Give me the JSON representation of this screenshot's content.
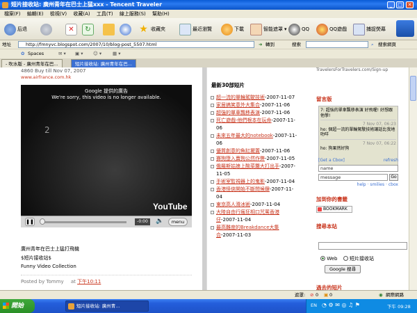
{
  "window": {
    "title": "短片接收站: 廣州青年在巴士上猛xxx - Tencent Traveler"
  },
  "menu": [
    "檔案(F)",
    "編輯(E)",
    "檢視(V)",
    "收藏(A)",
    "工具(T)",
    "線上服務(S)",
    "幫助(H)"
  ],
  "toolbar": {
    "back": "后退",
    "favorites": "收藏夾",
    "recent": "最近瀏覽",
    "download": "下載",
    "smart_block": "智能遮罩",
    "qq": "QQ",
    "qq_game": "QQ遊戲",
    "capture": "捕捉熒幕"
  },
  "address": {
    "label": "地址",
    "url": "http://fmnyvc.blogspot.com/2007/10/blog-post_5507.html",
    "go": "轉到",
    "search_label": "搜索",
    "search_web": "搜索網頁"
  },
  "linkbar": {
    "spaces": "Spaces"
  },
  "tabs": [
    {
      "label": "- 吹水版 - 廣州青年在巴..."
    },
    {
      "label": "短片接收站: 廣州青年在巴..."
    }
  ],
  "left": {
    "promo_line": "4860 Buy till Nov 07, 2007",
    "promo_url": "www.airfrance.com.hk",
    "ad_label": "Google 提供的廣告",
    "video_msg": "We're sorry, this video is no longer available.",
    "video_number": "2",
    "time": "-0:00",
    "menu_btn": "menu",
    "youtube": "YouTube",
    "caption1": "廣州青年在巴士上猛打飛機",
    "caption2": "$短片接收站$",
    "caption3": "Funny Video Collection",
    "posted_by": "Posted by Tommy",
    "posted_at": "at",
    "posted_time": "下午10:11"
  },
  "middle": {
    "heading": "最新30部短片",
    "items": [
      {
        "title": "超一流的單輪駕駛技術",
        "date": "-2007-11-07"
      },
      {
        "title": "家居搞笑意外大集合",
        "date": "-2007-11-06"
      },
      {
        "title": "超強的單車飄移表演",
        "date": "-2007-11-06"
      },
      {
        "title": "死亡遊戲-他們根本在玩命",
        "date": "-2007-11-06"
      },
      {
        "title": "未來五年最大的notebook",
        "date": "-2007-11-06"
      },
      {
        "title": "優質創意的魚缸擺置",
        "date": "-2007-11-06"
      },
      {
        "title": "賽狗墮入賣狗公然作弊",
        "date": "-2007-11-05"
      },
      {
        "title": "俄羅斯姑娘上酸菜籮大打出手",
        "date": "-2007-11-05"
      },
      {
        "title": "手術室監視器上的鬼影",
        "date": "-2007-11-04"
      },
      {
        "title": "香港怪俠開始不斷問候肆",
        "date": "-2007-11-04"
      },
      {
        "title": "東京高人滑冰術",
        "date": "-2007-11-04"
      },
      {
        "title": "大陸自由行瘋狂相口咒罵香港仔",
        "date": "-2007-11-04"
      },
      {
        "title": "最高難度的Breakdance大集合",
        "date": "-2007-11-03"
      }
    ]
  },
  "right": {
    "signup": "TravelersForTravelers.com/Sign-up",
    "guestbook": "留言版",
    "cbox_messages": [
      {
        "text": "7: 超強的單車飄移表演 好飛喔! 好想跟他學!"
      },
      {
        "time": "7 Nov 07, 06:23",
        "text": "ho: 個超一流的單輪駕駛技術讓話比我地叻咩"
      },
      {
        "time": "7 Nov 07, 06:22",
        "text": "ho: 狗果然好狗"
      }
    ],
    "get_cbox": "[Get a Cbox]",
    "refresh": "refresh",
    "name_ph": "name",
    "message_ph": "message",
    "go_btn": "Go",
    "links": "help · smilies · cbox",
    "bookmark_heading": "加到你的書籤",
    "bookmark_btn": "BOOKMARK",
    "search_heading": "搜尋本站",
    "radio_web": "Web",
    "radio_site": "短片接收站",
    "google_btn": "Google 搜尋",
    "past_heading": "過去的短片"
  },
  "status": {
    "left": "遮罩:",
    "count1": "0",
    "count2": "0",
    "zoom": "網際網路"
  },
  "taskbar": {
    "start": "開始",
    "task": "短片接收站: 廣州青...",
    "lang": "EN",
    "clock": "下午 09:28"
  },
  "colors": {
    "accent": "#c8331b",
    "titlebar": "#0a5bd6",
    "taskbar": "#245edb"
  }
}
